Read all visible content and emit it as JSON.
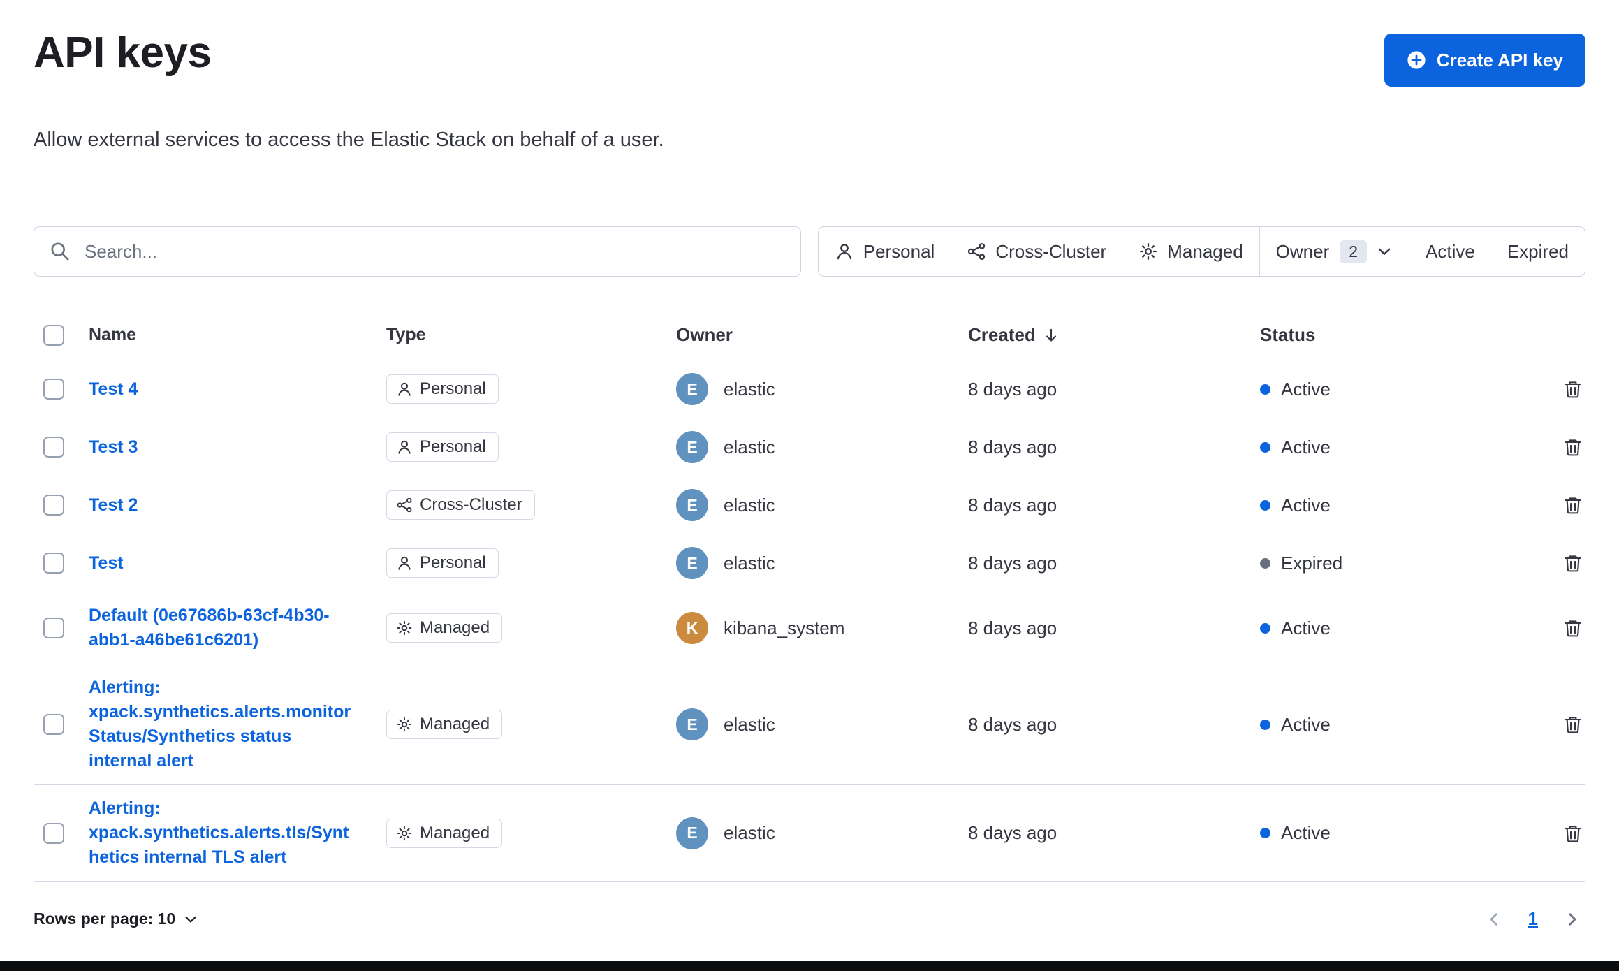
{
  "page": {
    "title": "API keys",
    "subtitle": "Allow external services to access the Elastic Stack on behalf of a user.",
    "create_button_label": "Create API key"
  },
  "search": {
    "placeholder": "Search..."
  },
  "filters": {
    "personal_label": "Personal",
    "cross_cluster_label": "Cross-Cluster",
    "managed_label": "Managed",
    "owner_label": "Owner",
    "owner_count": "2",
    "active_label": "Active",
    "expired_label": "Expired"
  },
  "table": {
    "headers": {
      "name": "Name",
      "type": "Type",
      "owner": "Owner",
      "created": "Created",
      "status": "Status"
    },
    "rows": [
      {
        "name": "Test 4",
        "type": "Personal",
        "owner": "elastic",
        "owner_initial": "E",
        "created": "8 days ago",
        "status": "Active"
      },
      {
        "name": "Test 3",
        "type": "Personal",
        "owner": "elastic",
        "owner_initial": "E",
        "created": "8 days ago",
        "status": "Active"
      },
      {
        "name": "Test 2",
        "type": "Cross-Cluster",
        "owner": "elastic",
        "owner_initial": "E",
        "created": "8 days ago",
        "status": "Active"
      },
      {
        "name": "Test",
        "type": "Personal",
        "owner": "elastic",
        "owner_initial": "E",
        "created": "8 days ago",
        "status": "Expired"
      },
      {
        "name": "Default (0e67686b-63cf-4b30-abb1-a46be61c6201)",
        "type": "Managed",
        "owner": "kibana_system",
        "owner_initial": "K",
        "created": "8 days ago",
        "status": "Active"
      },
      {
        "name": "Alerting: xpack.synthetics.alerts.monitorStatus/Synthetics status internal alert",
        "type": "Managed",
        "owner": "elastic",
        "owner_initial": "E",
        "created": "8 days ago",
        "status": "Active"
      },
      {
        "name": "Alerting: xpack.synthetics.alerts.tls/Synthetics internal TLS alert",
        "type": "Managed",
        "owner": "elastic",
        "owner_initial": "E",
        "created": "8 days ago",
        "status": "Active"
      }
    ]
  },
  "footer": {
    "rows_per_page_label": "Rows per page: 10",
    "current_page": "1"
  },
  "colors": {
    "accent": "#0B64DD",
    "link": "#0B64DD",
    "status_active": "#0B64DD",
    "status_expired": "#69707D",
    "avatar_elastic": "#6092C0",
    "avatar_kibana_system": "#CA8B3E"
  }
}
